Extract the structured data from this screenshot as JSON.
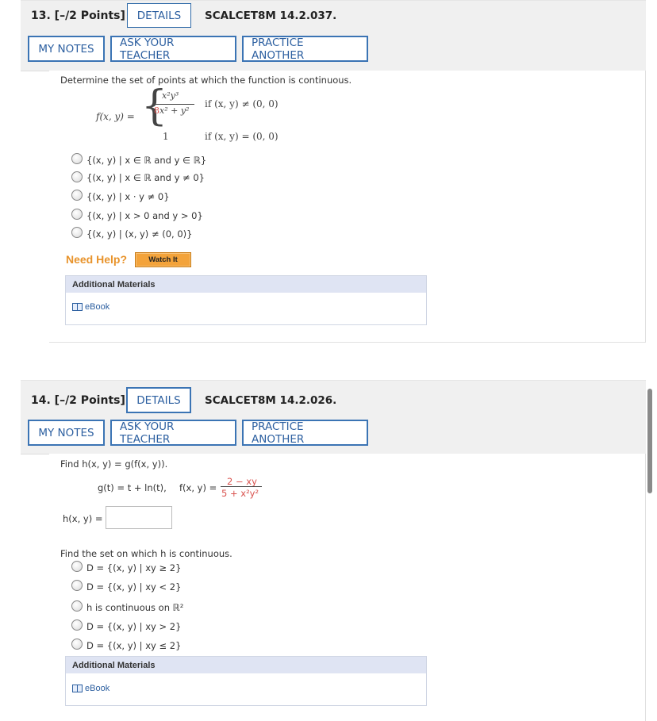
{
  "q13": {
    "number": "13. [–/2 Points]",
    "details_label": "DETAILS",
    "code": "SCALCET8M 14.2.037.",
    "my_notes_label": "MY NOTES",
    "ask_teacher_label": "ASK YOUR TEACHER",
    "practice_label": "PRACTICE ANOTHER",
    "prompt": "Determine the set of points at which the function is continuous.",
    "func_lhs": "f(x, y) =",
    "frac_num": "x²y³",
    "frac_den_red": "8",
    "frac_den_rest": "x² + y²",
    "case1_cond": "if  (x, y) ≠ (0, 0)",
    "case2_val": "1",
    "case2_cond": "if  (x, y) = (0, 0)",
    "options": [
      "{(x, y) | x ∈ ℝ and y ∈ ℝ}",
      "{(x, y) | x ∈ ℝ and y ≠ 0}",
      "{(x, y) | x · y ≠ 0}",
      "{(x, y) | x > 0 and y > 0}",
      "{(x, y) | (x, y) ≠ (0, 0)}"
    ],
    "need_help": "Need Help?",
    "watch_it": "Watch It",
    "additional_materials": "Additional Materials",
    "ebook": "eBook"
  },
  "q14": {
    "number": "14. [–/2 Points]",
    "details_label": "DETAILS",
    "code": "SCALCET8M 14.2.026.",
    "my_notes_label": "MY NOTES",
    "ask_teacher_label": "ASK YOUR TEACHER",
    "practice_label": "PRACTICE ANOTHER",
    "prompt": "Find  h(x, y) = g(f(x, y)).",
    "g_def": "g(t) = t + ln(t),",
    "f_lhs": "f(x, y) =",
    "f_num": "2 − xy",
    "f_den": "5 + x²y²",
    "h_label": "h(x, y) =",
    "h_value": "",
    "prompt2": "Find the set on which h is continuous.",
    "options": [
      "D = {(x, y) | xy ≥ 2}",
      "D = {(x, y) | xy < 2}",
      "h is continuous on ℝ²",
      "D = {(x, y) | xy > 2}",
      "D = {(x, y) | xy ≤ 2}"
    ],
    "additional_materials": "Additional Materials",
    "ebook": "eBook"
  }
}
